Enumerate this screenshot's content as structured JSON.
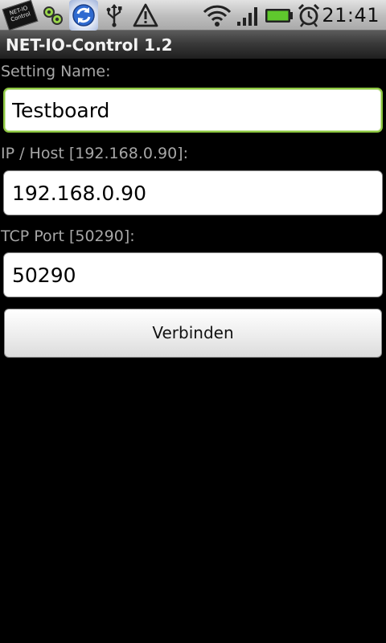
{
  "status_bar": {
    "app_icon_text": "NET-IO Control",
    "icons": [
      "net-io-app-icon",
      "link-icon",
      "sync-icon",
      "usb-icon",
      "warning-icon",
      "wifi-icon",
      "signal-icon",
      "battery-icon",
      "alarm-icon"
    ],
    "time": "21:41"
  },
  "title_bar": {
    "title": "NET-IO-Control 1.2"
  },
  "form": {
    "setting_name_label": "Setting Name:",
    "setting_name_value": "Testboard",
    "ip_label": "IP / Host [192.168.0.90]:",
    "ip_value": "192.168.0.90",
    "port_label": "TCP Port [50290]:",
    "port_value": "50290",
    "connect_button": "Verbinden"
  },
  "colors": {
    "background": "#000000",
    "focus_border": "#8cc63f",
    "label_text": "#a7a7a7",
    "battery": "#5fc82d"
  }
}
